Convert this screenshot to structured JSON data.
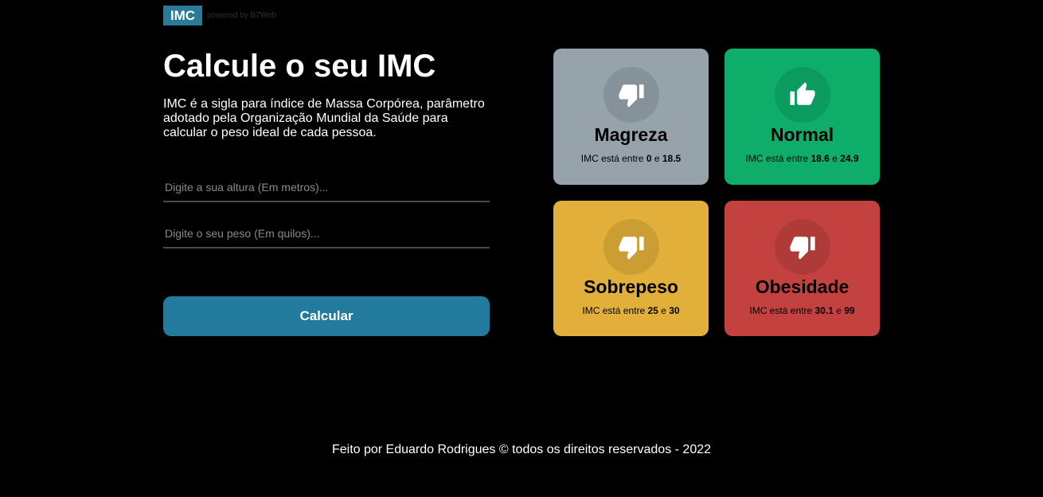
{
  "header": {
    "logo": "IMC",
    "powered_by": "powered by B7Web"
  },
  "main": {
    "title": "Calcule o seu IMC",
    "description": "IMC é a sigla para índice de Massa Corpórea, parâmetro adotado pela Organização Mundial da Saúde para calcular o peso ideal de cada pessoa.",
    "height_field": {
      "placeholder": "Digite a sua altura (Em metros)...",
      "value": ""
    },
    "weight_field": {
      "placeholder": "Digite o seu peso (Em quilos)...",
      "value": ""
    },
    "calculate_label": "Calcular"
  },
  "cards": [
    {
      "title": "Magreza",
      "icon": "thumbs-down-icon",
      "color": "#96a3ab",
      "range_prefix": "IMC está entre",
      "min": "0",
      "joiner": "e",
      "max": "18.5"
    },
    {
      "title": "Normal",
      "icon": "thumbs-up-icon",
      "color": "#0ead69",
      "range_prefix": "IMC está entre",
      "min": "18.6",
      "joiner": "e",
      "max": "24.9"
    },
    {
      "title": "Sobrepeso",
      "icon": "thumbs-down-icon",
      "color": "#e2b03a",
      "range_prefix": "IMC está entre",
      "min": "25",
      "joiner": "e",
      "max": "30"
    },
    {
      "title": "Obesidade",
      "icon": "thumbs-down-icon",
      "color": "#c3423f",
      "range_prefix": "IMC está entre",
      "min": "30.1",
      "joiner": "e",
      "max": "99"
    }
  ],
  "footer": {
    "text": "Feito por Eduardo Rodrigues © todos os direitos reservados - 2022"
  }
}
